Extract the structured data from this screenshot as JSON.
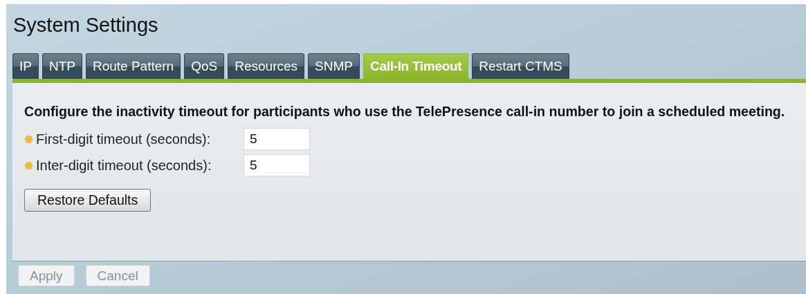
{
  "window": {
    "title": "System Settings"
  },
  "tabs": [
    {
      "label": "IP",
      "selected": false
    },
    {
      "label": "NTP",
      "selected": false
    },
    {
      "label": "Route Pattern",
      "selected": false
    },
    {
      "label": "QoS",
      "selected": false
    },
    {
      "label": "Resources",
      "selected": false
    },
    {
      "label": "SNMP",
      "selected": false
    },
    {
      "label": "Call-In Timeout",
      "selected": true
    },
    {
      "label": "Restart CTMS",
      "selected": false
    }
  ],
  "description": "Configure the inactivity timeout for participants who use the TelePresence call-in number to join a scheduled meeting.",
  "fields": [
    {
      "label": "First-digit timeout (seconds):",
      "value": "5",
      "required": true
    },
    {
      "label": "Inter-digit timeout (seconds):",
      "value": "5",
      "required": true
    }
  ],
  "restore_button": "Restore Defaults",
  "footer_buttons": [
    {
      "label": "Apply",
      "disabled": true
    },
    {
      "label": "Cancel",
      "disabled": true
    }
  ]
}
